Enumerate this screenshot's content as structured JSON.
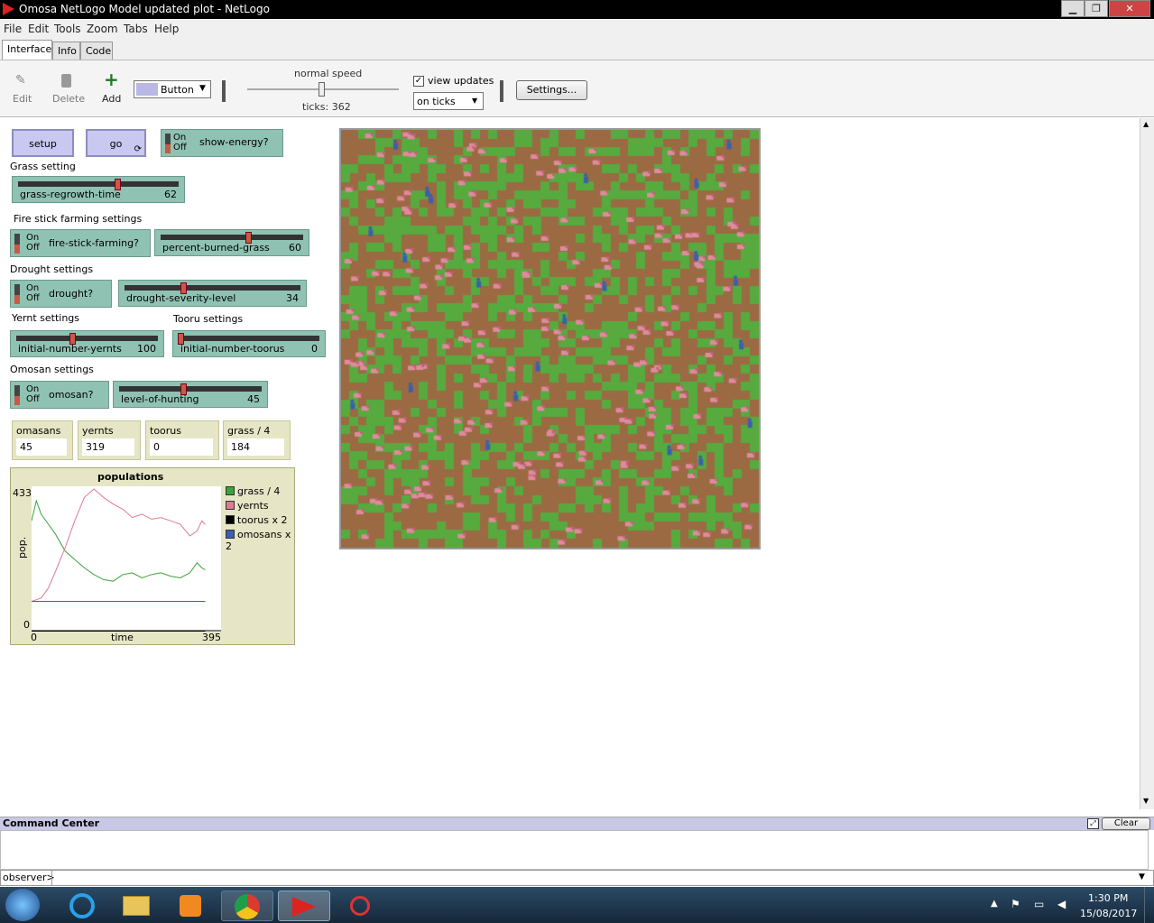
{
  "window": {
    "title": "Omosa NetLogo Model updated plot - NetLogo"
  },
  "menu": [
    "File",
    "Edit",
    "Tools",
    "Zoom",
    "Tabs",
    "Help"
  ],
  "tabs": [
    "Interface",
    "Info",
    "Code"
  ],
  "toolbar": {
    "edit": "Edit",
    "delete": "Delete",
    "add": "Add",
    "widget_type": "Button",
    "speed_label": "normal speed",
    "ticks": "ticks: 362",
    "view_updates": "view updates",
    "update_mode": "on ticks",
    "settings": "Settings..."
  },
  "widgets": {
    "setup": "setup",
    "go": "go",
    "show_energy": "show-energy?",
    "grass_setting": "Grass setting",
    "grass_regrowth": {
      "label": "grass-regrowth-time",
      "value": "62",
      "fraction": 0.62
    },
    "fire_settings": "Fire stick farming settings",
    "fire_stick": "fire-stick-farming?",
    "percent_burned": {
      "label": "percent-burned-grass",
      "value": "60",
      "fraction": 0.6
    },
    "drought_settings": "Drought settings",
    "drought": "drought?",
    "drought_severity": {
      "label": "drought-severity-level",
      "value": "34",
      "fraction": 0.34
    },
    "yernt_settings": "Yernt settings",
    "tooru_settings": "Tooru settings",
    "initial_yernts": {
      "label": "initial-number-yernts",
      "value": "100",
      "fraction": 0.4
    },
    "initial_toorus": {
      "label": "initial-number-toorus",
      "value": "0",
      "fraction": 0.0
    },
    "omosan_settings": "Omosan settings",
    "omosan": "omosan?",
    "hunting": {
      "label": "level-of-hunting",
      "value": "45",
      "fraction": 0.45
    },
    "switch_on": "On",
    "switch_off": "Off"
  },
  "monitors": [
    {
      "label": "omasans",
      "value": "45"
    },
    {
      "label": "yernts",
      "value": "319"
    },
    {
      "label": "toorus",
      "value": "0"
    },
    {
      "label": "grass / 4",
      "value": "184"
    }
  ],
  "chart_data": {
    "type": "line",
    "title": "populations",
    "xlabel": "time",
    "ylabel": "pop.",
    "xlim": [
      0,
      395
    ],
    "ylim": [
      0,
      433
    ],
    "x_ticks": [
      "0",
      "395"
    ],
    "y_ticks": [
      "0",
      "433"
    ],
    "series": [
      {
        "name": "grass / 4",
        "color": "#3aa23a",
        "x": [
          0,
          10,
          20,
          35,
          50,
          70,
          90,
          110,
          130,
          150,
          170,
          190,
          210,
          230,
          250,
          270,
          290,
          310,
          330,
          345,
          355,
          362
        ],
        "values": [
          330,
          390,
          350,
          320,
          290,
          240,
          215,
          190,
          170,
          155,
          150,
          170,
          175,
          160,
          170,
          175,
          165,
          160,
          175,
          205,
          190,
          184
        ]
      },
      {
        "name": "yernts",
        "color": "#e07a90",
        "x": [
          0,
          10,
          20,
          35,
          50,
          70,
          90,
          110,
          130,
          150,
          170,
          190,
          210,
          230,
          250,
          270,
          290,
          310,
          330,
          345,
          355,
          362
        ],
        "values": [
          90,
          95,
          100,
          130,
          180,
          250,
          330,
          400,
          425,
          400,
          380,
          365,
          340,
          350,
          335,
          340,
          330,
          320,
          285,
          300,
          330,
          319
        ]
      },
      {
        "name": "toorus x 2",
        "color": "#000000",
        "x": [
          0,
          362
        ],
        "values": [
          0,
          0
        ]
      },
      {
        "name": "omosans x 2",
        "color": "#3a5fb0",
        "x": [
          0,
          362
        ],
        "values": [
          90,
          90
        ]
      }
    ]
  },
  "command_center": {
    "title": "Command Center",
    "clear": "Clear",
    "prompt": "observer>"
  },
  "taskbar": {
    "time": "1:30 PM",
    "date": "15/08/2017"
  }
}
